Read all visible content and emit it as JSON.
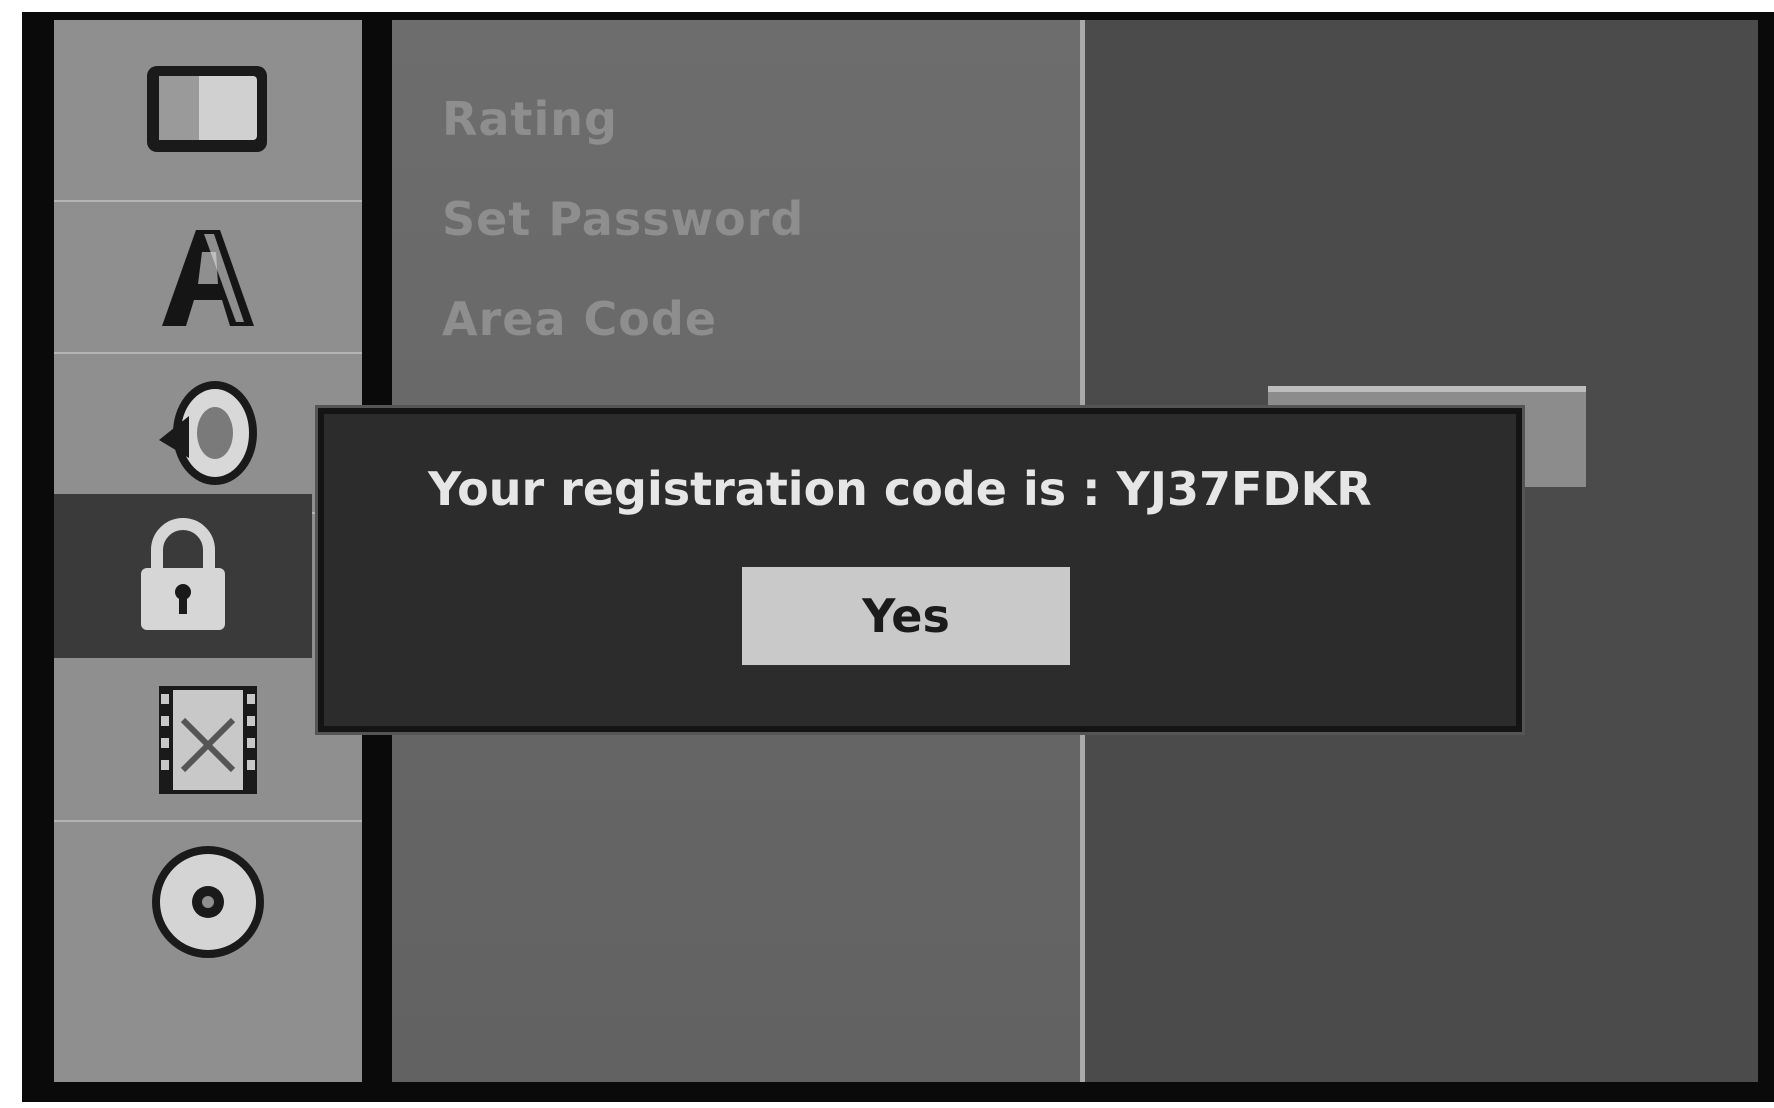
{
  "sidebar": {
    "icons": [
      {
        "name": "tv-screen-icon"
      },
      {
        "name": "language-icon",
        "glyph": "A"
      },
      {
        "name": "speaker-icon"
      },
      {
        "name": "lock-icon",
        "selected": true
      },
      {
        "name": "film-strip-icon"
      },
      {
        "name": "disc-icon"
      }
    ]
  },
  "menu": {
    "items": [
      "Rating",
      "Set Password",
      "Area Code"
    ]
  },
  "dialog": {
    "message": "Your registration code is : YJ37FDKR",
    "button_label": "Yes"
  },
  "colors": {
    "icon_bar": "#8f8f8f",
    "menu_panel": "#6a6a6a",
    "right_panel": "#4b4b4b",
    "dialog_bg": "#2c2c2c",
    "button_bg": "#c9c9c9"
  }
}
